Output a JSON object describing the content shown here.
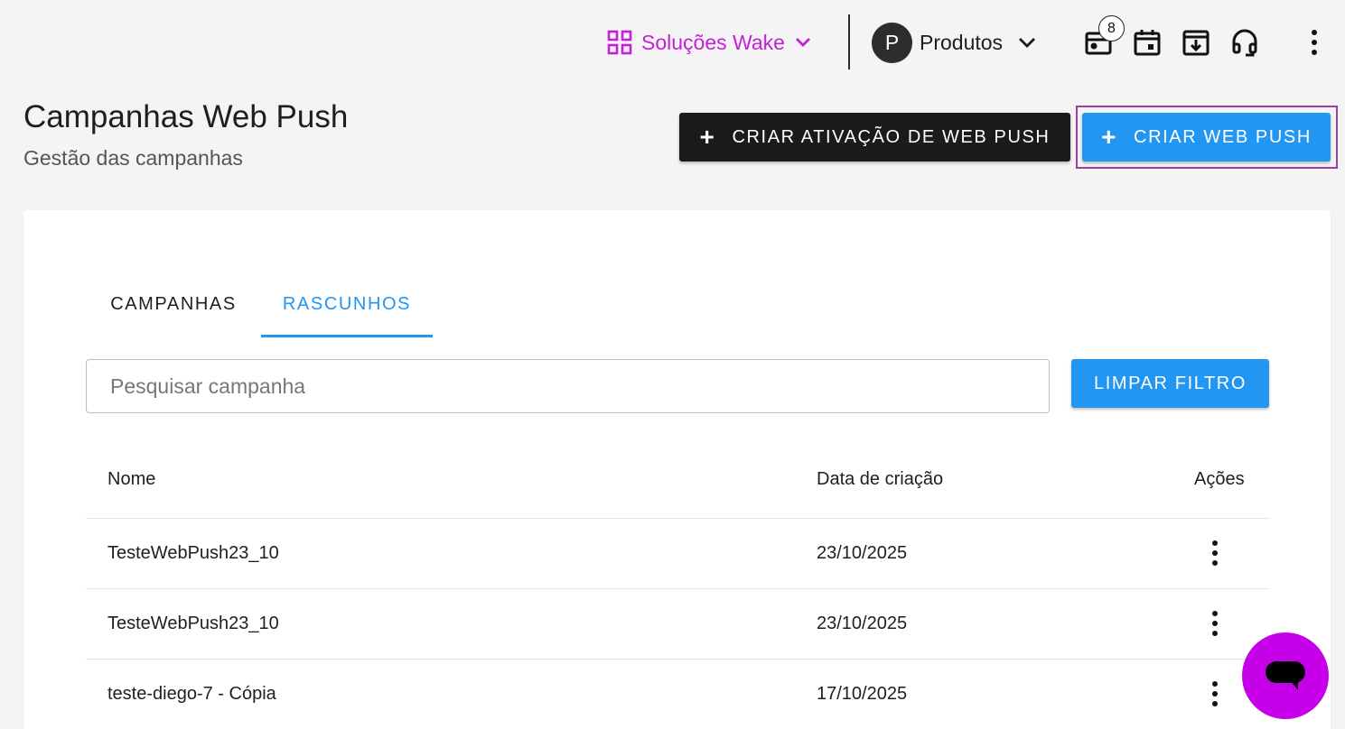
{
  "topbar": {
    "solutions_label": "Soluções Wake",
    "solutions_icon": "grid-icon",
    "avatar_initial": "P",
    "products_label": "Produtos",
    "notification_count": "8",
    "icons": [
      "notifications-icon",
      "calendar-icon",
      "download-box-icon",
      "headset-icon",
      "more-vert-icon"
    ]
  },
  "header": {
    "title": "Campanhas Web Push",
    "subtitle": "Gestão das campanhas",
    "btn_activation": "CRIAR ATIVAÇÃO DE WEB PUSH",
    "btn_create": "CRIAR WEB PUSH",
    "plus": "+"
  },
  "tabs": {
    "campanhas": "CAMPANHAS",
    "rascunhos": "RASCUNHOS",
    "active": "rascunhos"
  },
  "search": {
    "placeholder": "Pesquisar campanha",
    "clear_label": "LIMPAR FILTRO"
  },
  "table": {
    "headers": {
      "name": "Nome",
      "created": "Data de criação",
      "actions": "Ações"
    },
    "rows": [
      {
        "name": "TesteWebPush23_10",
        "created": "23/10/2025"
      },
      {
        "name": "TesteWebPush23_10",
        "created": "23/10/2025"
      },
      {
        "name": "teste-diego-7 - Cópia",
        "created": "17/10/2025"
      }
    ]
  },
  "colors": {
    "brand_purple": "#c51fd8",
    "primary_blue": "#2196f3",
    "dark_button": "#1b1b1b",
    "chat_fab": "#c600e8"
  }
}
